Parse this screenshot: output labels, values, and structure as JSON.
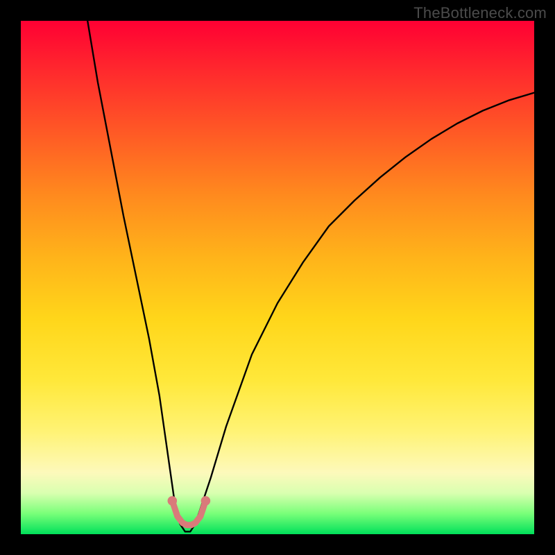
{
  "watermark": "TheBottleneck.com",
  "chart_data": {
    "type": "line",
    "title": "",
    "xlabel": "",
    "ylabel": "",
    "xlim": [
      0,
      100
    ],
    "ylim": [
      0,
      100
    ],
    "grid": false,
    "background": "rainbow-gradient (red top → green bottom)",
    "series": [
      {
        "name": "bottleneck-curve",
        "type": "line",
        "color": "#000000",
        "x": [
          13,
          15,
          17.5,
          20,
          22.5,
          25,
          27,
          28,
          29,
          30,
          31,
          32,
          33,
          34,
          35,
          37,
          40,
          45,
          50,
          55,
          60,
          65,
          70,
          75,
          80,
          85,
          90,
          95,
          100
        ],
        "y": [
          100,
          88,
          75,
          62,
          50,
          38,
          27,
          20,
          13,
          6,
          2,
          0.5,
          0.5,
          2,
          5,
          11,
          21,
          35,
          45,
          53,
          60,
          65,
          69.5,
          73.5,
          77,
          80,
          82.5,
          84.5,
          86
        ]
      },
      {
        "name": "bottom-marker-arc",
        "type": "scatter",
        "color": "#d97a7a",
        "marker_size": 9,
        "x": [
          29.5,
          30.5,
          31.5,
          32.3,
          33.2,
          34,
          35,
          36
        ],
        "y": [
          6.5,
          3.5,
          2.2,
          1.8,
          1.8,
          2.2,
          3.5,
          6.5
        ]
      }
    ],
    "annotations": []
  }
}
